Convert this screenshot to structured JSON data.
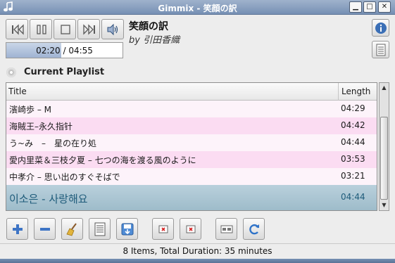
{
  "window": {
    "title": "Gimmix - 笑顔の訳",
    "minimize": "▁",
    "maximize": "□",
    "close": "✕"
  },
  "player": {
    "elapsed": "02:20",
    "total": "04:55",
    "time_display": "02:20 / 04:55",
    "progress": 0.475,
    "song_title": "笑顔の訳",
    "song_artist": "by 引田香織",
    "icons": [
      "previous-icon",
      "pause-icon",
      "stop-icon",
      "next-icon",
      "volume-icon",
      "info-icon",
      "playlist-icon"
    ]
  },
  "playlist": {
    "label": "Current Playlist",
    "columns": [
      "Title",
      "Length"
    ],
    "rows": [
      {
        "title": "濱崎歩 – M",
        "length": "04:29"
      },
      {
        "title": "海賊王–永久指针",
        "length": "04:42"
      },
      {
        "title": "う~み　–　星の在り処",
        "length": "04:44"
      },
      {
        "title": "愛内里菜＆三枝夕夏 – 七つの海を渡る風のように",
        "length": "03:53"
      },
      {
        "title": "中孝介 – 思い出のすぐそばで",
        "length": "03:21"
      },
      {
        "title": "이소은 - 사랑해요",
        "length": "04:44"
      }
    ]
  },
  "toolbar_icons": [
    "add-icon",
    "remove-icon",
    "clear-broom-icon",
    "list-icon",
    "save-playlist-icon",
    "crop-icon",
    "delete-icon",
    "view-icon",
    "refresh-icon"
  ],
  "status": "8 Items, Total Duration: 35 minutes",
  "colors": {
    "titlebar": "#7f96b9",
    "row_pink": "#fbdcf2",
    "row_current": "#adc8d5",
    "accent_blue": "#1e5b7a"
  }
}
